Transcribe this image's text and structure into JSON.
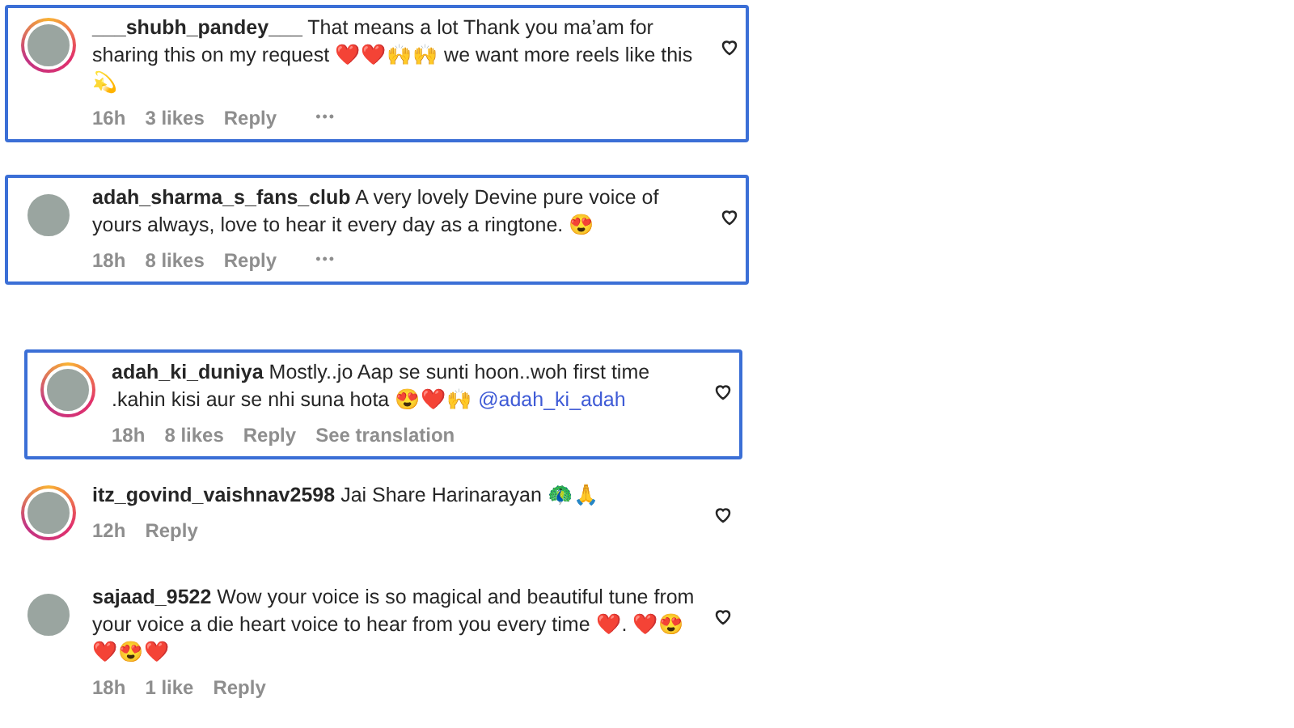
{
  "comments": [
    {
      "username": "___shubh_pandey___",
      "text": "That means a lot Thank you ma’am for sharing this on my request ❤️❤️🙌🙌 we want more reels like this💫",
      "highlighted": true,
      "story_ring": true,
      "meta": [
        {
          "kind": "time",
          "label": "16h"
        },
        {
          "kind": "likes",
          "label": "3 likes"
        },
        {
          "kind": "reply",
          "label": "Reply"
        },
        {
          "kind": "more",
          "label": "•••"
        }
      ]
    },
    {
      "username": "adah_sharma_s_fans_club",
      "text": "A very lovely Devine pure voice of yours always, love to hear it every day as a ringtone. 😍",
      "highlighted": true,
      "story_ring": false,
      "meta": [
        {
          "kind": "time",
          "label": "18h"
        },
        {
          "kind": "likes",
          "label": "8 likes"
        },
        {
          "kind": "reply",
          "label": "Reply"
        },
        {
          "kind": "more",
          "label": "•••"
        }
      ]
    },
    {
      "username": "adah_ki_duniya",
      "text": "Mostly..jo Aap se sunti hoon..woh first time .kahin kisi aur se nhi suna hota 😍❤️🙌",
      "mention": "@adah_ki_adah",
      "highlighted": true,
      "story_ring": true,
      "meta": [
        {
          "kind": "time",
          "label": "18h"
        },
        {
          "kind": "likes",
          "label": "8 likes"
        },
        {
          "kind": "reply",
          "label": "Reply"
        },
        {
          "kind": "translation",
          "label": "See translation"
        }
      ]
    },
    {
      "username": "itz_govind_vaishnav2598",
      "text": "Jai Share Harinarayan 🦚🙏",
      "highlighted": false,
      "story_ring": true,
      "meta": [
        {
          "kind": "time",
          "label": "12h"
        },
        {
          "kind": "reply",
          "label": "Reply"
        }
      ]
    },
    {
      "username": "sajaad_9522",
      "text": "Wow your voice is so magical and beautiful tune from your voice a die heart voice to hear from you every time ❤️. ❤️😍❤️😍❤️",
      "highlighted": false,
      "story_ring": false,
      "meta": [
        {
          "kind": "time",
          "label": "18h"
        },
        {
          "kind": "likes",
          "label": "1 like"
        },
        {
          "kind": "reply",
          "label": "Reply"
        }
      ]
    }
  ]
}
